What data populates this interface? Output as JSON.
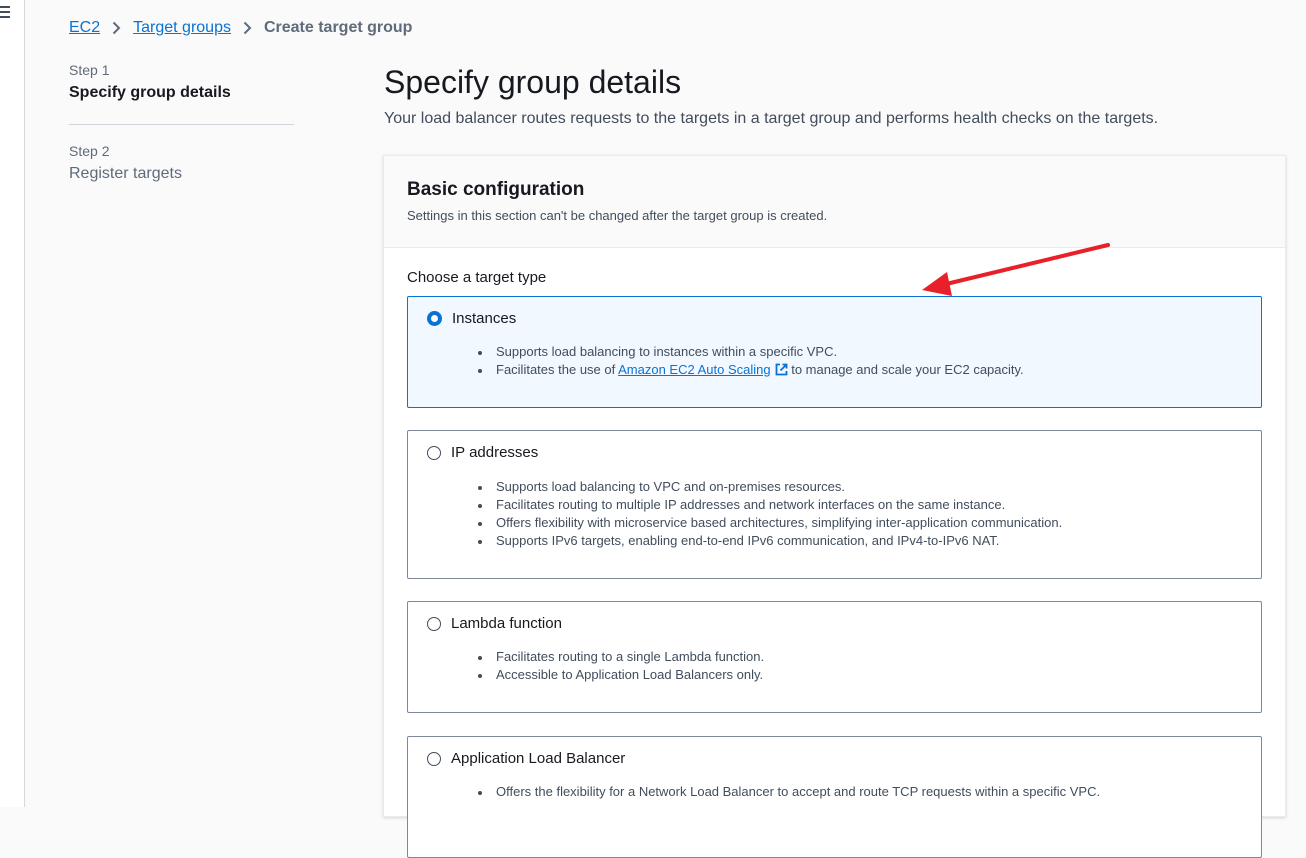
{
  "breadcrumb": {
    "items": [
      "EC2",
      "Target groups"
    ],
    "current": "Create target group"
  },
  "steps": [
    {
      "label": "Step 1",
      "title": "Specify group details"
    },
    {
      "label": "Step 2",
      "title": "Register targets"
    }
  ],
  "page": {
    "title": "Specify group details",
    "description": "Your load balancer routes requests to the targets in a target group and performs health checks on the targets."
  },
  "basic_config": {
    "title": "Basic configuration",
    "description": "Settings in this section can't be changed after the target group is created.",
    "target_type_label": "Choose a target type"
  },
  "target_types": [
    {
      "label": "Instances",
      "selected": true,
      "bullets": [
        "Supports load balancing to instances within a specific VPC."
      ],
      "link_bullet": {
        "prefix": "Facilitates the use of ",
        "link": "Amazon EC2 Auto Scaling",
        "suffix": " to manage and scale your EC2 capacity."
      }
    },
    {
      "label": "IP addresses",
      "selected": false,
      "bullets": [
        "Supports load balancing to VPC and on-premises resources.",
        "Facilitates routing to multiple IP addresses and network interfaces on the same instance.",
        "Offers flexibility with microservice based architectures, simplifying inter-application communication.",
        "Supports IPv6 targets, enabling end-to-end IPv6 communication, and IPv4-to-IPv6 NAT."
      ]
    },
    {
      "label": "Lambda function",
      "selected": false,
      "bullets": [
        "Facilitates routing to a single Lambda function.",
        "Accessible to Application Load Balancers only."
      ]
    },
    {
      "label": "Application Load Balancer",
      "selected": false,
      "bullets": [
        "Offers the flexibility for a Network Load Balancer to accept and route TCP requests within a specific VPC."
      ]
    }
  ],
  "colors": {
    "link": "#0972d3",
    "selected_bg": "#f1f8ff",
    "annotation_arrow": "#e8202a"
  }
}
